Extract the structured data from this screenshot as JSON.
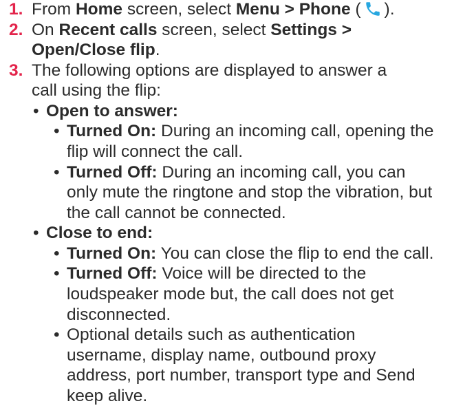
{
  "steps": [
    {
      "number": "1.",
      "pre": "From ",
      "b1": "Home",
      "mid": " screen, select ",
      "b2": "Menu > Phone",
      "open": " (",
      "close": ").",
      "icon": "phone-icon",
      "icon_color": "#27a7e0"
    },
    {
      "number": "2.",
      "pre": "On ",
      "b1": "Recent calls",
      "mid": " screen, select ",
      "b2": "Settings >",
      "cont": "Open/Close flip",
      "end": "."
    },
    {
      "number": "3.",
      "line1": "The following options are displayed to answer a",
      "line2": "call using the flip:"
    }
  ],
  "options": [
    {
      "title": "Open to answer:",
      "items": [
        {
          "label": "Turned On:",
          "l1": " During an incoming call, opening the",
          "lines": [
            "flip will connect the call."
          ]
        },
        {
          "label": "Turned Off:",
          "l1": " During an incoming call, you can",
          "lines": [
            "only mute the ringtone and stop the vibration, but",
            "the call cannot be connected."
          ]
        }
      ]
    },
    {
      "title": "Close to end:",
      "items": [
        {
          "label": "Turned On:",
          "l1": " You can close the flip to end the call.",
          "lines": []
        },
        {
          "label": "Turned Off:",
          "l1": " Voice will be directed to the",
          "lines": [
            "loudspeaker mode but, the call does not get",
            "disconnected."
          ]
        }
      ],
      "extra": {
        "lines": [
          "Optional details such as authentication",
          "username, display name, outbound proxy",
          "address, port number, transport type and Send",
          "keep alive."
        ]
      }
    }
  ],
  "accent_color": "#e3244b",
  "bullet_char": "•"
}
